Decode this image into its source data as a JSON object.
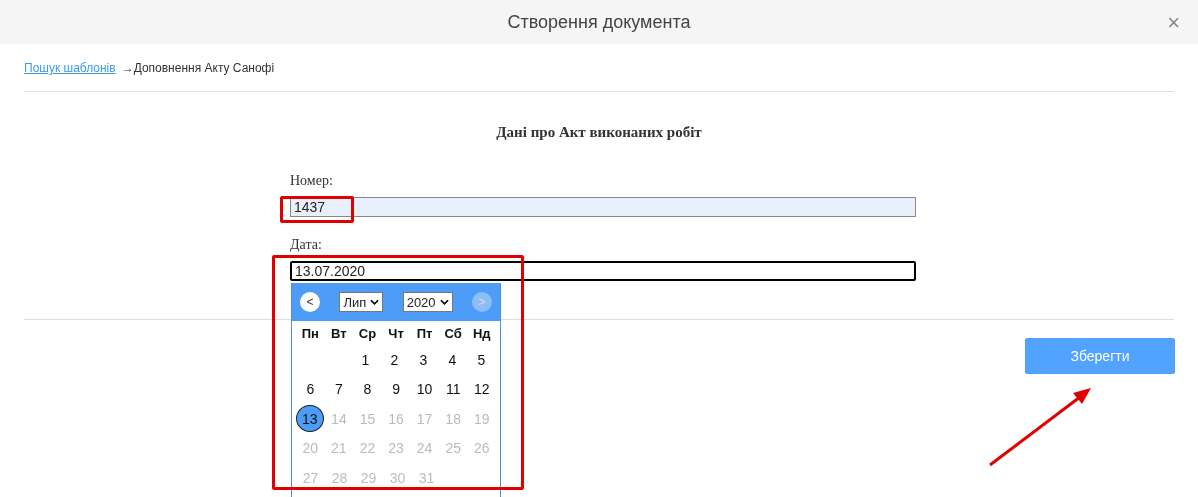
{
  "window": {
    "title": "Створення документа",
    "close": "×"
  },
  "breadcrumb": {
    "link": "Пошук шаблонів",
    "current": "→Доповнення Акту Санофі"
  },
  "form": {
    "heading": "Дані про Акт виконаних робіт",
    "fields": [
      {
        "label": "Номер:",
        "value": "1437",
        "focused": false
      },
      {
        "label": "Дата:",
        "value": "13.07.2020",
        "focused": true
      }
    ]
  },
  "datepicker": {
    "prev": "<",
    "next": ">",
    "next_disabled": true,
    "month": "Лип",
    "year": "2020",
    "weekdays": [
      "Пн",
      "Вт",
      "Ср",
      "Чт",
      "Пт",
      "Сб",
      "Нд"
    ],
    "weeks": [
      [
        {
          "day": "1",
          "disabled": false,
          "selected": false
        },
        {
          "day": "2",
          "disabled": false,
          "selected": false
        },
        {
          "day": "3",
          "disabled": false,
          "selected": false
        },
        {
          "day": "4",
          "disabled": false,
          "selected": false
        },
        {
          "day": "5",
          "disabled": false,
          "selected": false
        }
      ],
      [
        {
          "day": "6",
          "disabled": false,
          "selected": false
        },
        {
          "day": "7",
          "disabled": false,
          "selected": false
        },
        {
          "day": "8",
          "disabled": false,
          "selected": false
        },
        {
          "day": "9",
          "disabled": false,
          "selected": false
        },
        {
          "day": "10",
          "disabled": false,
          "selected": false
        },
        {
          "day": "11",
          "disabled": false,
          "selected": false
        },
        {
          "day": "12",
          "disabled": false,
          "selected": false
        }
      ],
      [
        {
          "day": "13",
          "disabled": false,
          "selected": true
        },
        {
          "day": "14",
          "disabled": true,
          "selected": false
        },
        {
          "day": "15",
          "disabled": true,
          "selected": false
        },
        {
          "day": "16",
          "disabled": true,
          "selected": false
        },
        {
          "day": "17",
          "disabled": true,
          "selected": false
        },
        {
          "day": "18",
          "disabled": true,
          "selected": false
        },
        {
          "day": "19",
          "disabled": true,
          "selected": false
        }
      ],
      [
        {
          "day": "20",
          "disabled": true,
          "selected": false
        },
        {
          "day": "21",
          "disabled": true,
          "selected": false
        },
        {
          "day": "22",
          "disabled": true,
          "selected": false
        },
        {
          "day": "23",
          "disabled": true,
          "selected": false
        },
        {
          "day": "24",
          "disabled": true,
          "selected": false
        },
        {
          "day": "25",
          "disabled": true,
          "selected": false
        },
        {
          "day": "26",
          "disabled": true,
          "selected": false
        }
      ],
      [
        {
          "day": "27",
          "disabled": true,
          "selected": false
        },
        {
          "day": "28",
          "disabled": true,
          "selected": false
        },
        {
          "day": "29",
          "disabled": true,
          "selected": false
        },
        {
          "day": "30",
          "disabled": true,
          "selected": false
        },
        {
          "day": "31",
          "disabled": true,
          "selected": false
        }
      ]
    ]
  },
  "save_button": "Зберегти",
  "annotations": [
    {
      "kind": "box"
    },
    {
      "kind": "box"
    },
    {
      "kind": "arrow"
    }
  ]
}
